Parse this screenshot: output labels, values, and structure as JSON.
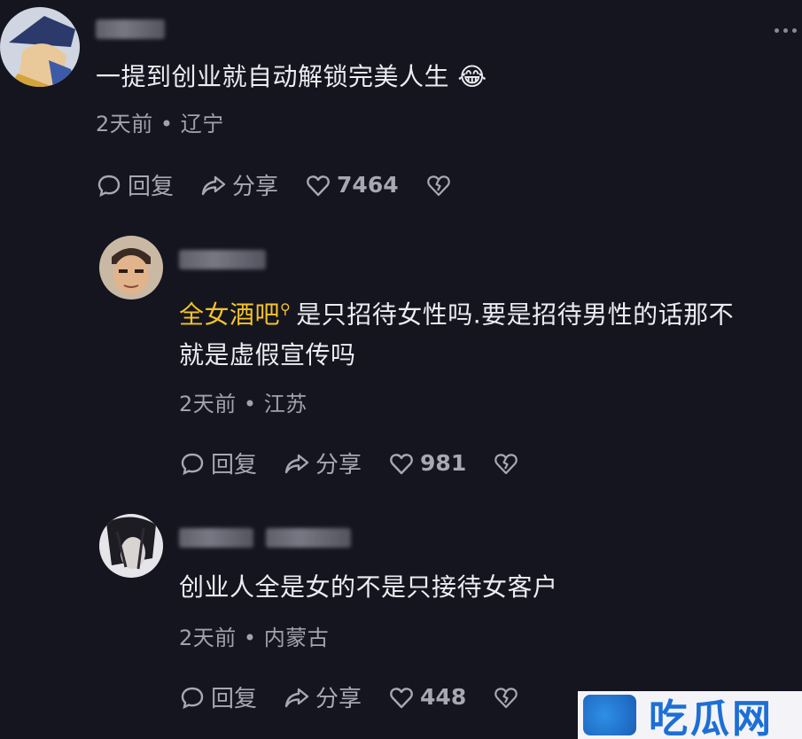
{
  "comments": [
    {
      "text": "一提到创业就自动解锁完美人生 😂",
      "time": "2天前",
      "location": "辽宁",
      "reply": "回复",
      "share": "分享",
      "likes": "7464"
    },
    {
      "keyword": "全女酒吧",
      "text_line1": "是只招待女性吗.要是招待男性的话那不",
      "text_line2": "就是虚假宣传吗",
      "time": "2天前",
      "location": "江苏",
      "reply": "回复",
      "share": "分享",
      "likes": "981"
    },
    {
      "text": "创业人全是女的不是只接待女客户",
      "time": "2天前",
      "location": "内蒙古",
      "reply": "回复",
      "share": "分享",
      "likes": "448"
    }
  ],
  "separator": "•",
  "watermark": {
    "text": "吃瓜网"
  },
  "icons": [
    "more-options-icon",
    "reply-icon",
    "share-icon",
    "like-heart-icon",
    "dislike-heart-icon",
    "search-icon"
  ],
  "colors": {
    "background": "#15151f",
    "keyword": "#f3c428",
    "meta": "#a2a2ae",
    "watermark": "#1d6fd6"
  }
}
